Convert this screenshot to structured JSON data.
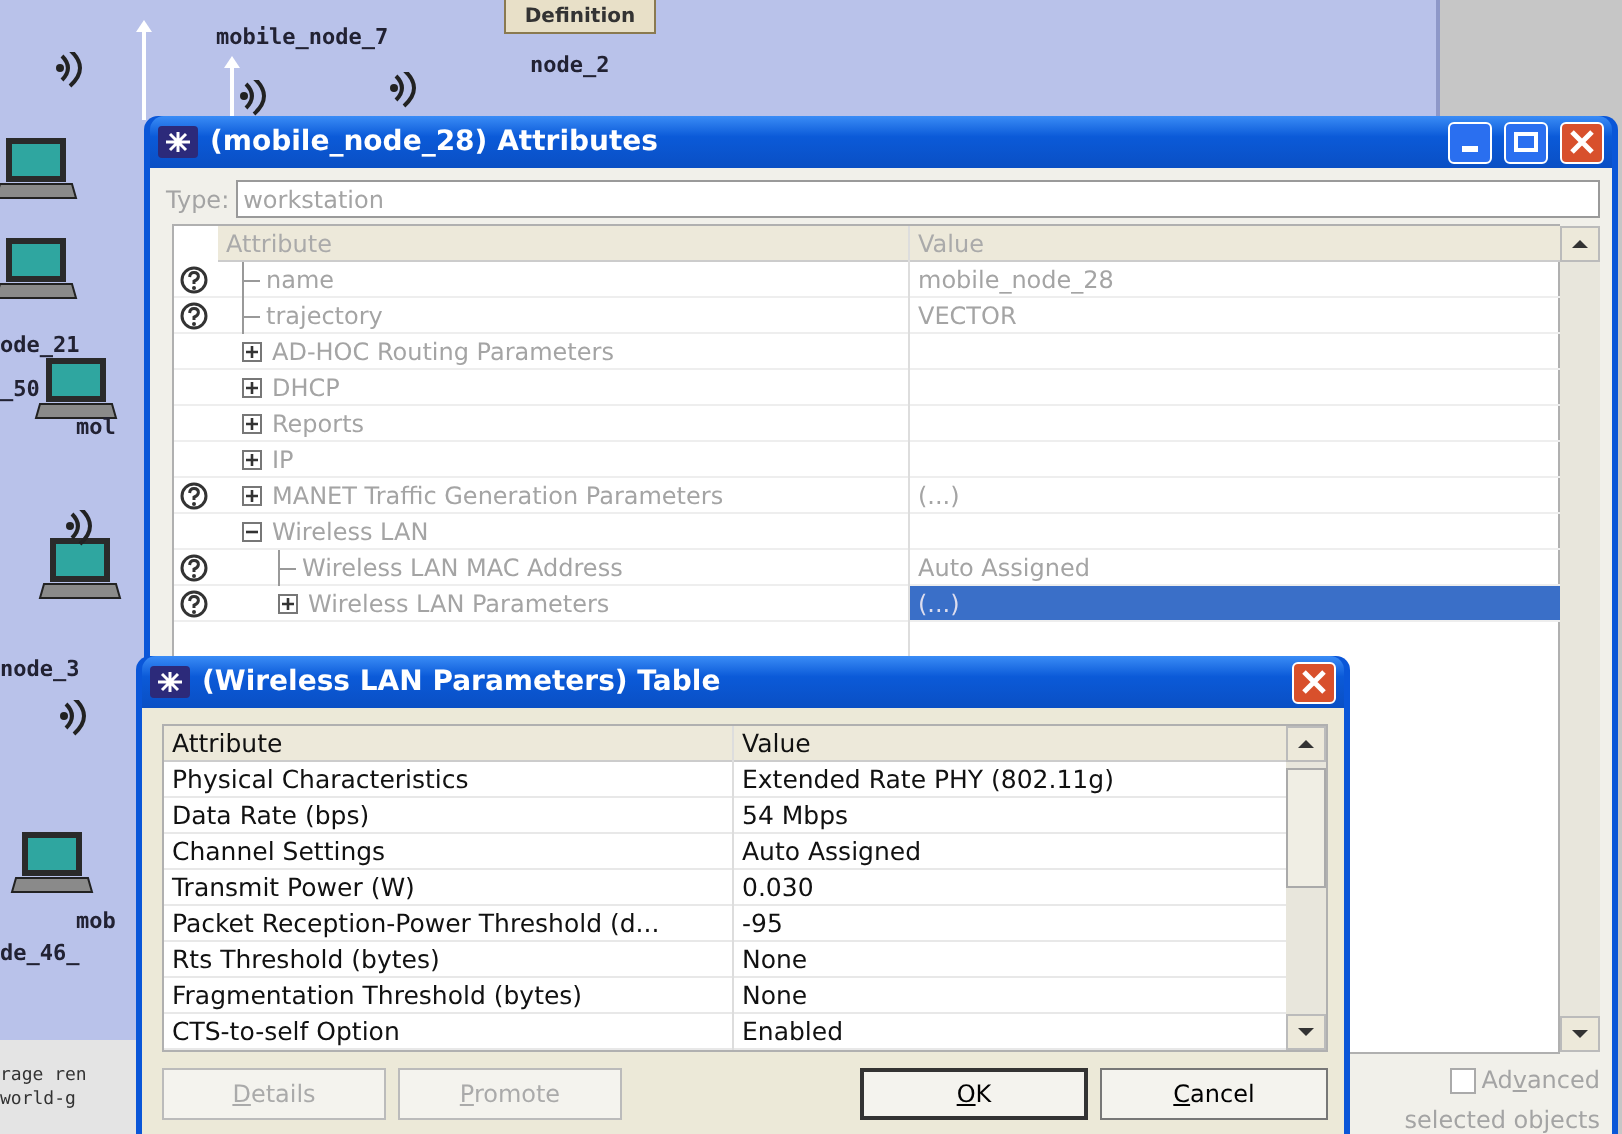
{
  "canvas": {
    "definition_button": "Definition",
    "labels": [
      "mobile_node_7",
      "node_2",
      "ode_21",
      "_50",
      "mol",
      "node_3",
      "mob",
      "de_46_"
    ],
    "log_lines": [
      "rage ren",
      "world-g"
    ]
  },
  "attributes_window": {
    "title": "(mobile_node_28) Attributes",
    "type_label": "Type:",
    "type_value": "workstation",
    "columns": [
      "Attribute",
      "Value"
    ],
    "rows": [
      {
        "kind": "leaf",
        "help": true,
        "label": "name",
        "value": "mobile_node_28",
        "selected": false
      },
      {
        "kind": "leaf",
        "help": true,
        "label": "trajectory",
        "value": "VECTOR",
        "selected": false
      },
      {
        "kind": "group",
        "help": false,
        "expanded": false,
        "label": "AD-HOC Routing Parameters",
        "selected": false
      },
      {
        "kind": "group",
        "help": false,
        "expanded": false,
        "label": "DHCP",
        "selected": false
      },
      {
        "kind": "group",
        "help": false,
        "expanded": false,
        "label": "Reports",
        "selected": false
      },
      {
        "kind": "group",
        "help": false,
        "expanded": false,
        "label": "IP",
        "selected": false
      },
      {
        "kind": "group",
        "help": true,
        "expanded": false,
        "label": "MANET Traffic Generation Parameters",
        "value": "(...)",
        "selected": false
      },
      {
        "kind": "group",
        "help": false,
        "expanded": true,
        "label": "Wireless LAN",
        "selected": false,
        "children": [
          {
            "kind": "leaf",
            "help": true,
            "label": "Wireless LAN MAC Address",
            "value": "Auto Assigned",
            "selected": false
          },
          {
            "kind": "group",
            "help": true,
            "expanded": false,
            "label": "Wireless LAN Parameters",
            "value": "(...)",
            "selected": true
          }
        ]
      }
    ],
    "advanced": {
      "label_before": "Ad",
      "label_key": "v",
      "label_after": "anced",
      "checked": false
    },
    "footer_text": "selected objects"
  },
  "table_dialog": {
    "title": "(Wireless LAN Parameters) Table",
    "columns": [
      "Attribute",
      "Value"
    ],
    "rows": [
      {
        "attribute": "Physical Characteristics",
        "value": "Extended Rate PHY (802.11g)"
      },
      {
        "attribute": "Data Rate (bps)",
        "value": "54 Mbps"
      },
      {
        "attribute": "Channel Settings",
        "value": "Auto Assigned"
      },
      {
        "attribute": "Transmit Power (W)",
        "value": "0.030"
      },
      {
        "attribute": "Packet Reception-Power Threshold (d...",
        "value": "-95"
      },
      {
        "attribute": "Rts Threshold (bytes)",
        "value": "None"
      },
      {
        "attribute": "Fragmentation Threshold (bytes)",
        "value": "None"
      },
      {
        "attribute": "CTS-to-self Option",
        "value": "Enabled"
      }
    ],
    "buttons": [
      {
        "label_key": "D",
        "label_after": "etails",
        "disabled": true
      },
      {
        "label_key": "P",
        "label_after": "romote",
        "disabled": true
      },
      {
        "label_key": "O",
        "label_after": "K",
        "disabled": false
      },
      {
        "label_key": "C",
        "label_after": "ancel",
        "disabled": false
      }
    ]
  }
}
